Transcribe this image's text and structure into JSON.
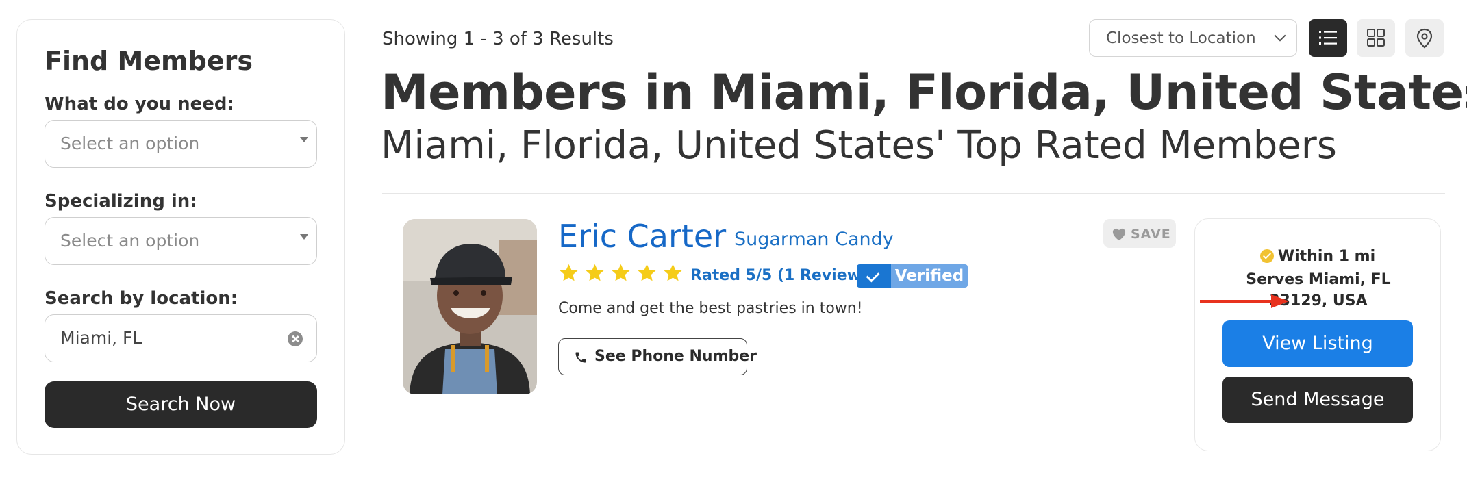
{
  "sidebar": {
    "title": "Find Members",
    "need_label": "What do you need:",
    "need_placeholder": "Select an option",
    "specializing_label": "Specializing in:",
    "specializing_placeholder": "Select an option",
    "location_label": "Search by location:",
    "location_value": "Miami, FL",
    "search_button": "Search Now"
  },
  "results": {
    "showing": "Showing 1 - 3 of 3 Results",
    "sort_selected": "Closest to Location",
    "title": "Members in Miami, Florida, United States",
    "subtitle": "Miami, Florida, United States' Top Rated Members"
  },
  "member": {
    "name": "Eric Carter",
    "company": "Sugarman Candy",
    "stars": 5,
    "rating_text": "Rated 5/5 (1 Review)",
    "verified_label": "Verified",
    "description": "Come and get the best pastries in town!",
    "phone_button": "See Phone Number",
    "save_label": "SAVE",
    "within": "Within 1 mi",
    "serves": "Serves Miami, FL 33129, USA",
    "view_listing": "View Listing",
    "send_message": "Send Message"
  },
  "colors": {
    "link_blue": "#1a6fc4",
    "primary_button": "#1b7fe6",
    "dark_button": "#2a2a2a",
    "star": "#f5cc19",
    "arrow": "#e8321e"
  },
  "icons": [
    "list-view-icon",
    "grid-view-icon",
    "map-pin-icon",
    "heart-icon",
    "phone-icon",
    "check-icon",
    "clear-icon",
    "chevron-down-icon"
  ]
}
